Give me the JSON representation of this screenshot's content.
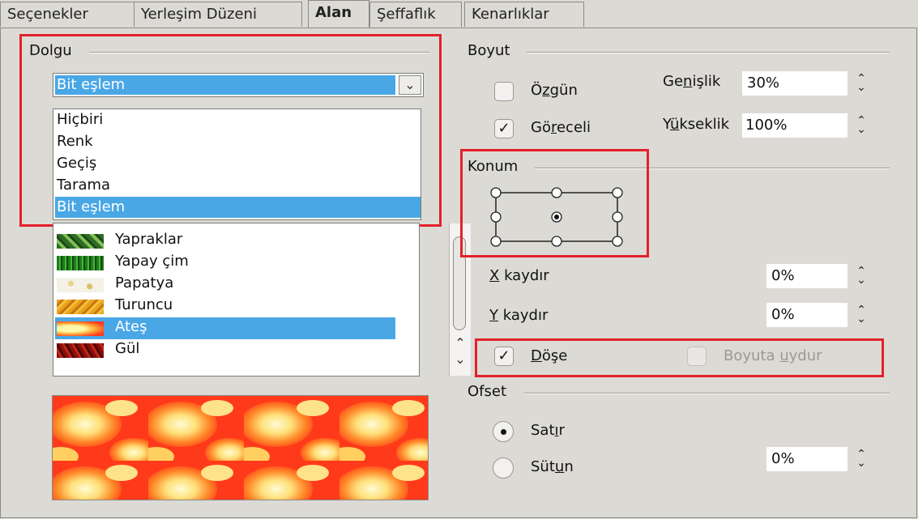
{
  "tabs": [
    {
      "label": "Seçenekler"
    },
    {
      "label": "Yerleşim Düzeni"
    },
    {
      "label": "Alan"
    },
    {
      "label": "Şeffaflık"
    },
    {
      "label": "Kenarlıklar"
    }
  ],
  "fill": {
    "group_label": "Dolgu",
    "selected": "Bit eşlem",
    "options": [
      "Hiçbiri",
      "Renk",
      "Geçiş",
      "Tarama",
      "Bit eşlem"
    ],
    "bitmaps": [
      "Yapraklar",
      "Yapay çim",
      "Papatya",
      "Turuncu",
      "Ateş",
      "Gül"
    ],
    "selected_bitmap": "Ateş"
  },
  "size": {
    "group_label": "Boyut",
    "original_pre": "Ö",
    "original_u": "z",
    "original_post": "gün",
    "relative_pre": "Gö",
    "relative_u": "r",
    "relative_post": "eceli",
    "width_pre": "Ge",
    "width_u": "n",
    "width_post": "işlik",
    "width_value": "30%",
    "height_pre": "Y",
    "height_u": "ü",
    "height_post": "kseklik",
    "height_value": "100%"
  },
  "position": {
    "group_label": "Konum",
    "x_u": "X",
    "x_post": " kaydır",
    "x_value": "0%",
    "y_u": "Y",
    "y_post": " kaydır",
    "y_value": "0%",
    "tile_u": "D",
    "tile_post": "öşe",
    "autofit_pre": "Boyuta ",
    "autofit_u": "u",
    "autofit_post": "ydur"
  },
  "offset": {
    "group_label": "Ofset",
    "row_pre": "Sat",
    "row_u": "ı",
    "row_post": "r",
    "column_pre": "Süt",
    "column_u": "u",
    "column_post": "n",
    "value": "0%"
  },
  "colors": {
    "highlight": "#4aa7e6",
    "annotation": "#e3212b"
  }
}
